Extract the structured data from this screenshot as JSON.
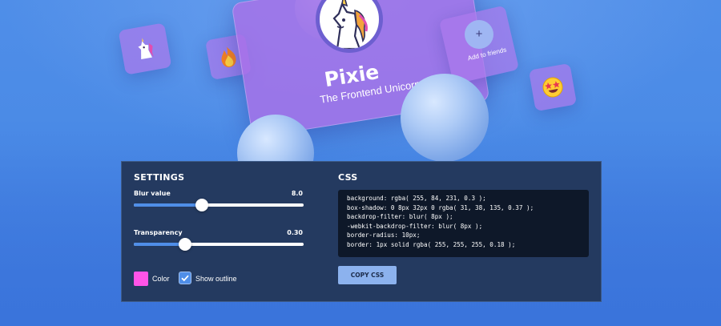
{
  "profile_card": {
    "name": "Pixie",
    "role": "The Frontend Unicorn",
    "avatar_icon": "unicorn-icon",
    "add_friends_label": "Add to friends",
    "add_icon": "plus-icon",
    "tile_icons": [
      "unicorn-emoji-icon",
      "fire-emoji-icon",
      "star-struck-emoji-icon"
    ]
  },
  "settings": {
    "title": "SETTINGS",
    "blur": {
      "label": "Blur value",
      "value": "8.0",
      "fraction": 0.4
    },
    "transparency": {
      "label": "Transparency",
      "value": "0.30",
      "fraction": 0.3
    },
    "color_label": "Color",
    "color_value": "#ff54e7",
    "show_outline_label": "Show outline",
    "show_outline_checked": true
  },
  "css": {
    "title": "CSS",
    "lines": [
      "background: rgba( 255, 84, 231, 0.3 );",
      "box-shadow: 0 8px 32px 0 rgba( 31, 38, 135, 0.37 );",
      "backdrop-filter: blur( 8px );",
      "-webkit-backdrop-filter: blur( 8px );",
      "border-radius: 10px;",
      "border: 1px solid rgba( 255, 255, 255, 0.18 );"
    ],
    "copy_button_label": "COPY CSS"
  },
  "colors": {
    "background": "#4a8ae6",
    "panel": "#243a60",
    "card": "#a870e8",
    "accent": "#4f8ee8",
    "button": "#8cb2ee"
  }
}
